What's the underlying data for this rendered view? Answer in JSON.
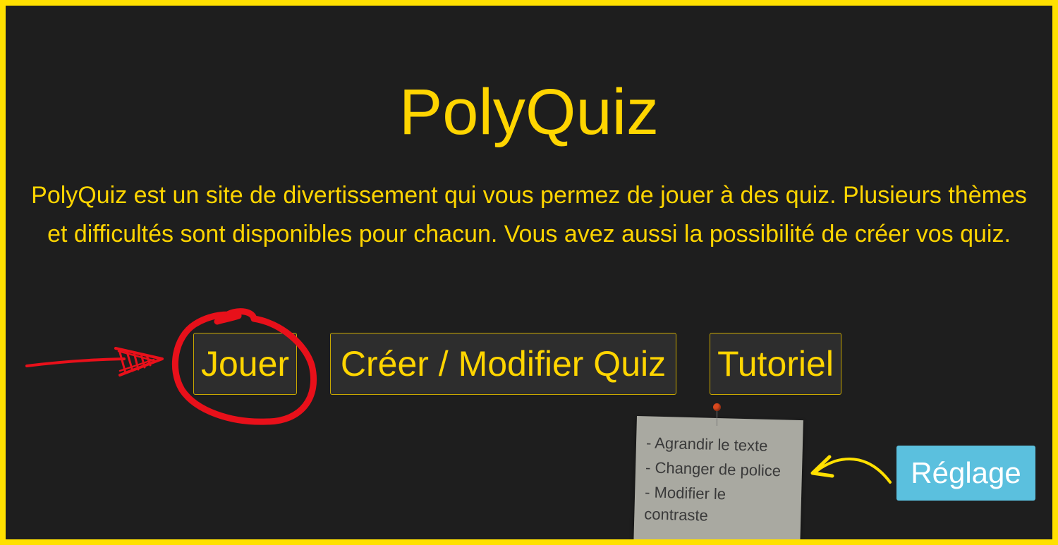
{
  "app": {
    "title": "PolyQuiz",
    "description": "PolyQuiz est un site de divertissement qui vous permez de jouer à des quiz. Plusieurs thèmes et difficultés sont disponibles pour chacun. Vous avez aussi la possibilité de créer vos quiz."
  },
  "buttons": {
    "play": "Jouer",
    "create": "Créer / Modifier Quiz",
    "tutorial": "Tutoriel",
    "settings": "Réglage"
  },
  "note": {
    "items": [
      "- Agrandir le texte",
      "- Changer de police",
      "- Modifier le contraste"
    ]
  },
  "colors": {
    "accent": "#ffd500",
    "background": "#1e1e1e",
    "frame": "#ffe000",
    "settings_button": "#5bc0de",
    "annotation_red": "#e8101a",
    "annotation_yellow": "#ffe000"
  }
}
